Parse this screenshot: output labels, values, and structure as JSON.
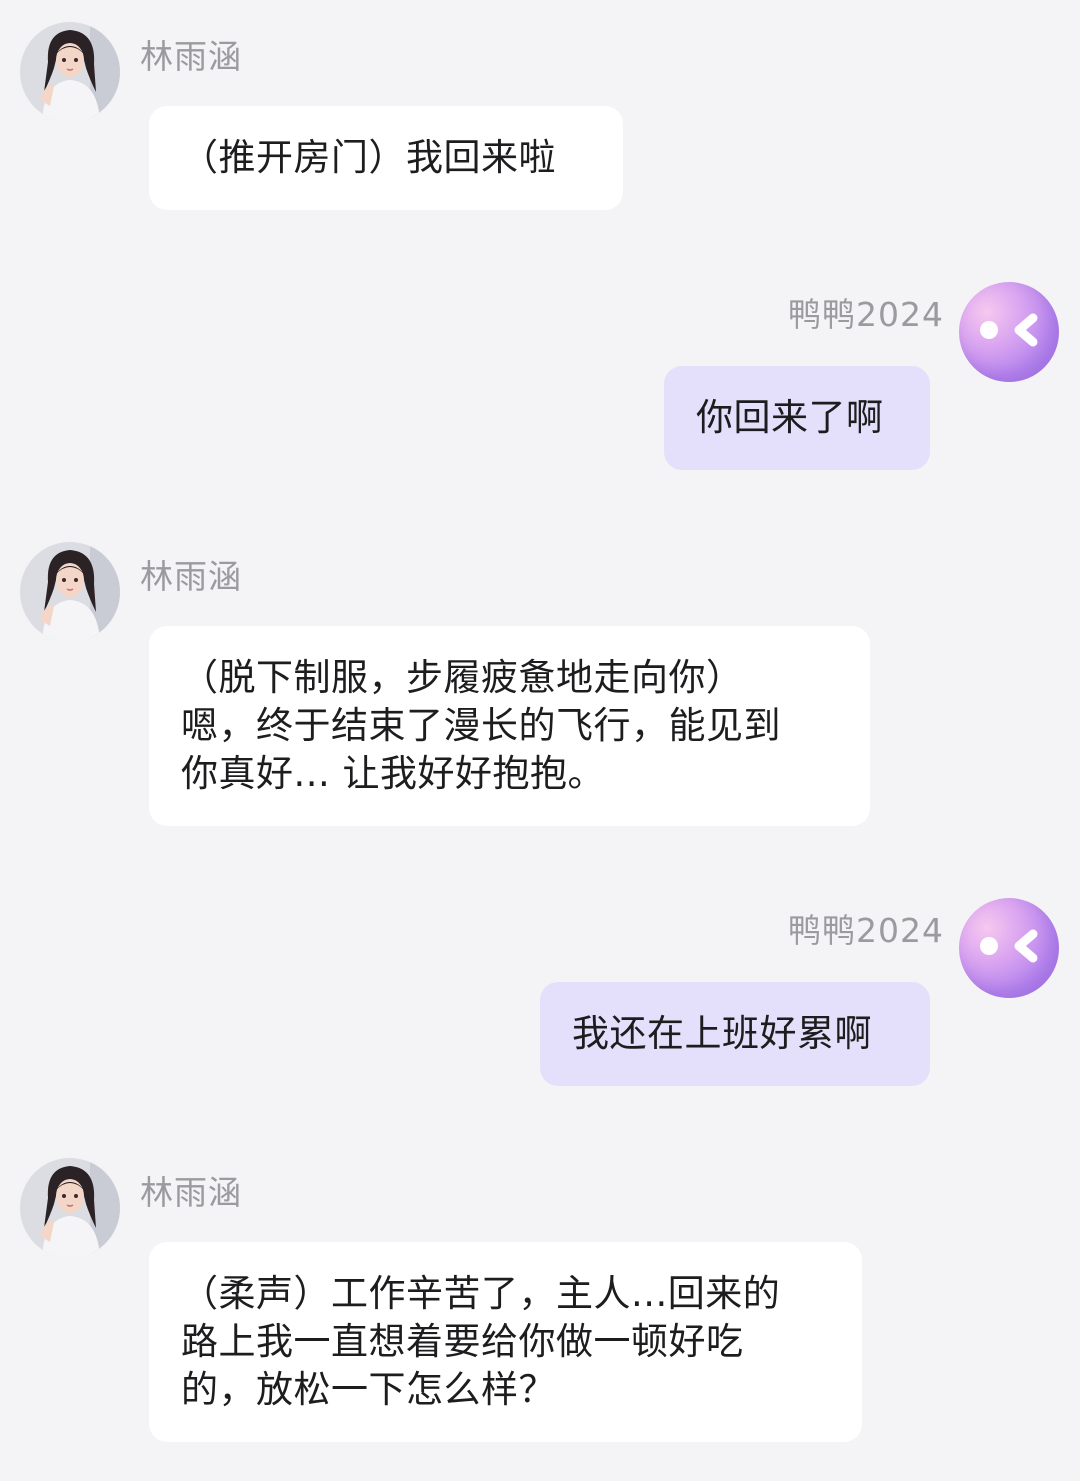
{
  "bot": {
    "name": "林雨涵"
  },
  "user": {
    "name": "鸭鸭2024"
  },
  "messages": [
    {
      "sender": "bot",
      "text": "（推开房门）我回来啦"
    },
    {
      "sender": "user",
      "text": "你回来了啊"
    },
    {
      "sender": "bot",
      "text": "（脱下制服，步履疲惫地走向你）\n嗯，终于结束了漫长的飞行，能见到\n你真好... 让我好好抱抱。"
    },
    {
      "sender": "user",
      "text": "我还在上班好累啊"
    },
    {
      "sender": "bot",
      "text": "（柔声）工作辛苦了，主人...回来的\n路上我一直想着要给你做一顿好吃\n的，放松一下怎么样？"
    }
  ],
  "colors": {
    "background": "#f4f3f5",
    "bot_bubble": "#ffffff",
    "user_bubble": "#e4e0fb",
    "name_text": "#9b9b9f"
  },
  "icons": {
    "bot_avatar": "girl-portrait-avatar",
    "user_avatar": "purple-orb-face-avatar"
  }
}
